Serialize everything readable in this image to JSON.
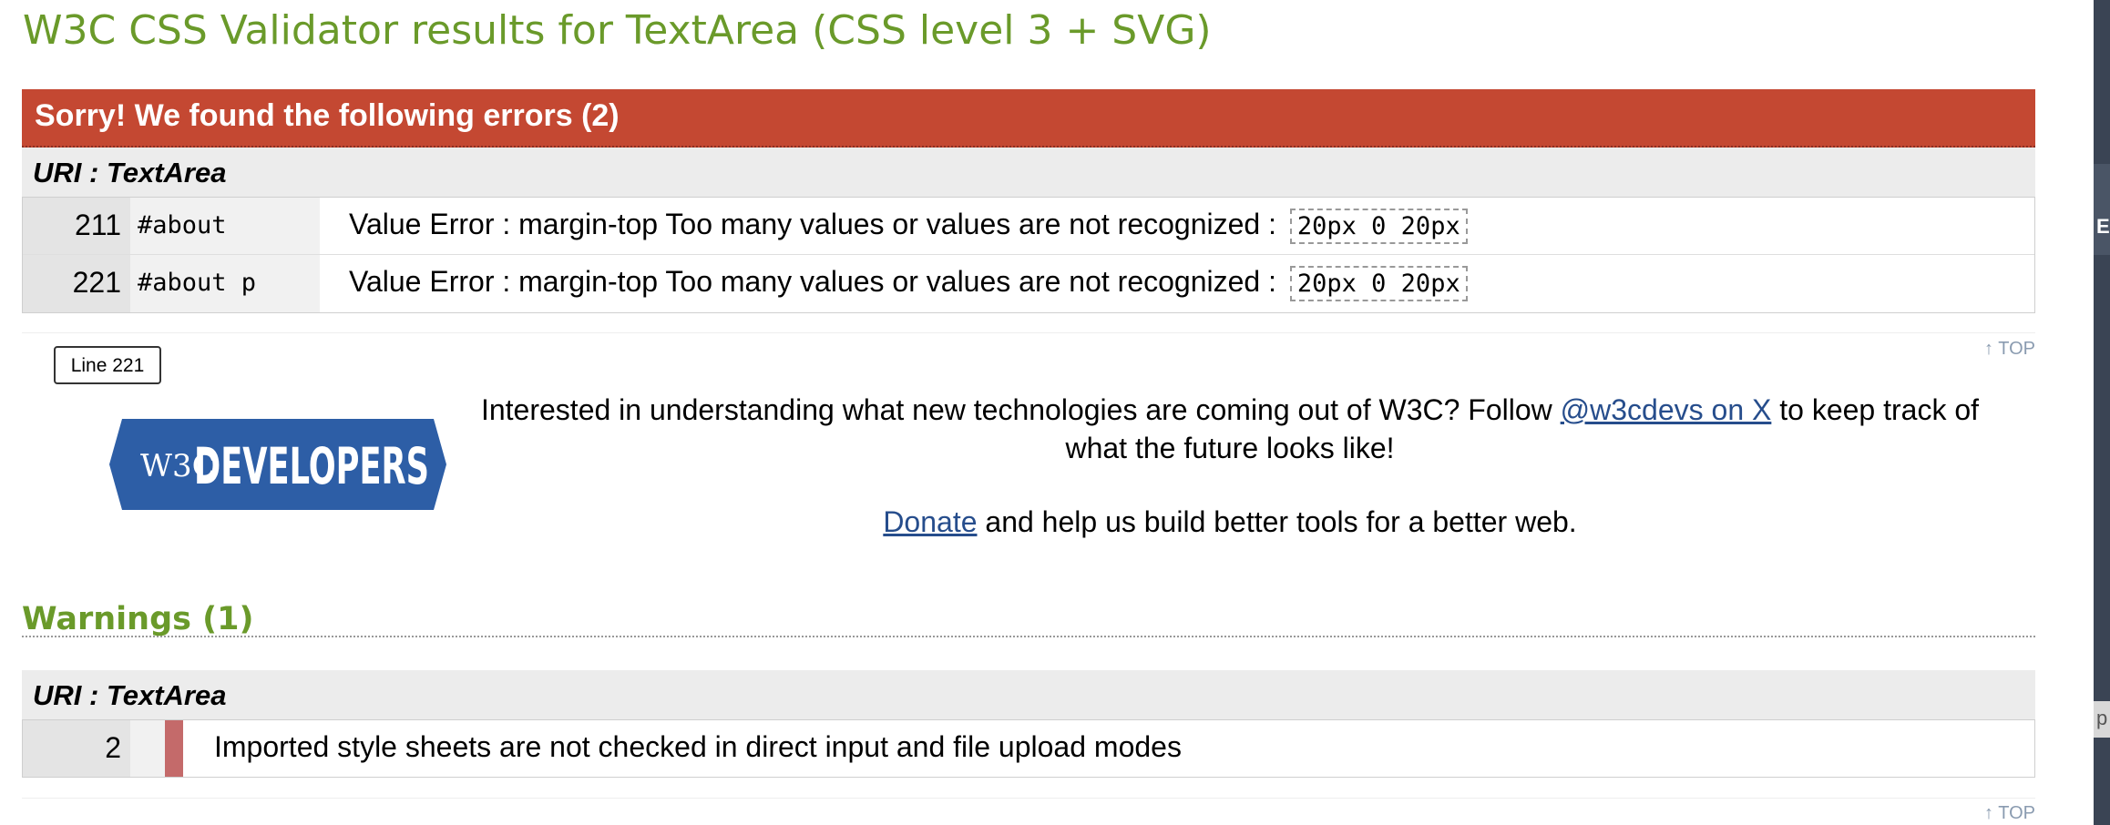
{
  "page_title": "W3C CSS Validator results for TextArea (CSS level 3 + SVG)",
  "errors": {
    "header": "Sorry! We found the following errors (2)",
    "uri_label": "URI : TextArea",
    "rows": [
      {
        "line": "211",
        "context": "#about",
        "message": "Value Error : margin-top Too many values or values are not recognized :",
        "value": "20px 0 20px"
      },
      {
        "line": "221",
        "context": "#about p",
        "message": "Value Error : margin-top Too many values or values are not recognized :",
        "value": "20px 0 20px"
      }
    ]
  },
  "top_link": "↑ TOP",
  "tooltip": "Line 221",
  "promo": {
    "logo_mark": "W3C",
    "logo_text": "DEVELOPERS",
    "text_before": "Interested in understanding what new technologies are coming out of W3C? Follow ",
    "link": "@w3cdevs on X",
    "text_after": " to keep track of what the future looks like!",
    "donate_link": "Donate",
    "donate_text": " and help us build better tools for a better web."
  },
  "warnings": {
    "title": "Warnings (1)",
    "uri_label": "URI : TextArea",
    "rows": [
      {
        "line": "2",
        "message": "Imported style sheets are not checked in direct input and file upload modes"
      }
    ]
  },
  "edge": {
    "letter_1": "E",
    "letter_2": "p"
  },
  "colors": {
    "title_green": "#6a9a2a",
    "error_red": "#c44832",
    "link_blue": "#264d8c",
    "logo_blue": "#2d5ea6"
  }
}
